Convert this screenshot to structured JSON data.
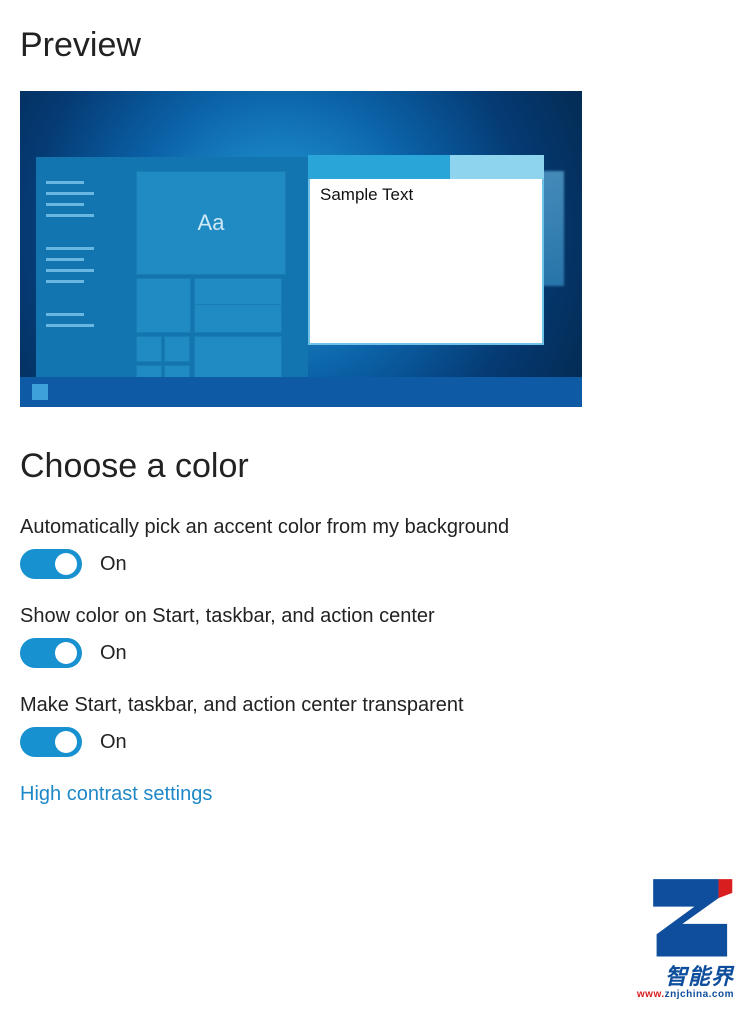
{
  "headings": {
    "preview": "Preview",
    "choose_color": "Choose a color"
  },
  "preview": {
    "tile_label": "Aa",
    "sample_window_text": "Sample Text"
  },
  "settings": {
    "auto_accent": {
      "label": "Automatically pick an accent color from my background",
      "state": "On"
    },
    "show_color": {
      "label": "Show color on Start, taskbar, and action center",
      "state": "On"
    },
    "transparency": {
      "label": "Make Start, taskbar, and action center transparent",
      "state": "On"
    }
  },
  "links": {
    "high_contrast": "High contrast settings"
  },
  "watermark": {
    "caption": "智能界",
    "domain_prefix": "www.",
    "domain": "znjchina.com"
  },
  "colors": {
    "accent": "#1791cf",
    "link": "#1e88c7"
  }
}
